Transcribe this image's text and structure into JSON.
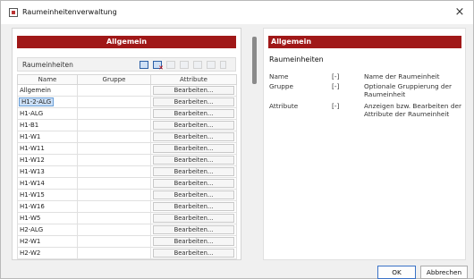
{
  "window": {
    "title": "Raumeinheitenverwaltung",
    "close_glyph": "×"
  },
  "left": {
    "banner": "Allgemein",
    "section_label": "Raumeinheiten",
    "columns": [
      "Name",
      "Gruppe",
      "Attribute"
    ],
    "edit_label": "Bearbeiten...",
    "rows": [
      {
        "name": "Allgemein",
        "gruppe": ""
      },
      {
        "name": "H1-2-ALG",
        "gruppe": ""
      },
      {
        "name": "H1-ALG",
        "gruppe": ""
      },
      {
        "name": "H1-B1",
        "gruppe": ""
      },
      {
        "name": "H1-W1",
        "gruppe": ""
      },
      {
        "name": "H1-W11",
        "gruppe": ""
      },
      {
        "name": "H1-W12",
        "gruppe": ""
      },
      {
        "name": "H1-W13",
        "gruppe": ""
      },
      {
        "name": "H1-W14",
        "gruppe": ""
      },
      {
        "name": "H1-W15",
        "gruppe": ""
      },
      {
        "name": "H1-W16",
        "gruppe": ""
      },
      {
        "name": "H1-W5",
        "gruppe": ""
      },
      {
        "name": "H2-ALG",
        "gruppe": ""
      },
      {
        "name": "H2-W1",
        "gruppe": ""
      },
      {
        "name": "H2-W2",
        "gruppe": ""
      }
    ],
    "selected_row": 1
  },
  "help": {
    "banner": "Allgemein",
    "heading": "Raumeinheiten",
    "entries": [
      {
        "key": "Name",
        "unit": "[-]",
        "desc": "Name der Raumeinheit"
      },
      {
        "key": "Gruppe",
        "unit": "[-]",
        "desc": "Optionale Gruppierung der Raumeinheit"
      },
      {
        "key": "Attribute",
        "unit": "[-]",
        "desc": "Anzeigen bzw. Bearbeiten der Attribute der Raumeinheit"
      }
    ]
  },
  "footer": {
    "ok": "OK",
    "cancel": "Abbrechen"
  },
  "colors": {
    "brand_red": "#a01818",
    "selection": "#cce0f7"
  }
}
